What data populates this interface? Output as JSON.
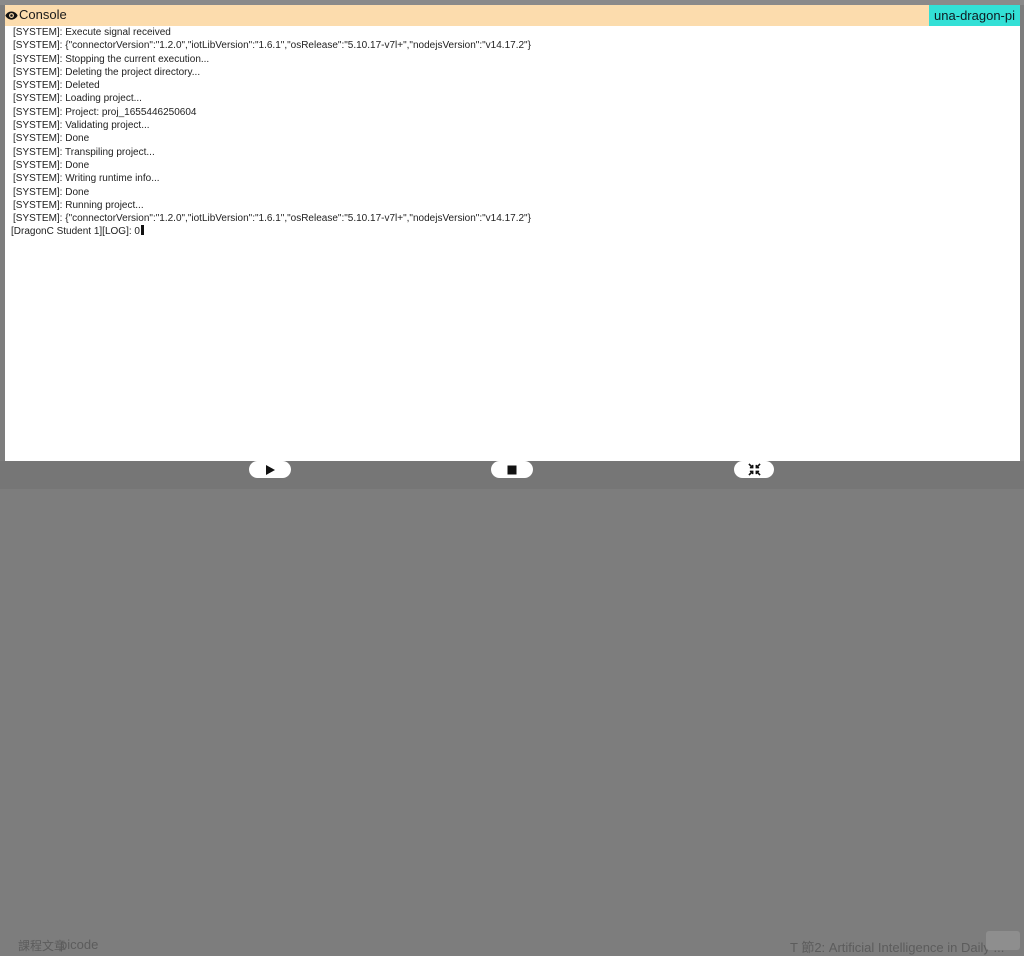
{
  "background": {
    "bottom_left_1": "課程文章",
    "bottom_left_2": "picode",
    "bottom_right": "T 節2: Artificial Intelligence in Daily ..."
  },
  "header": {
    "title": "Console",
    "device": "una-dragon-pi",
    "colors": {
      "header_bg": "#fcdcad",
      "device_bg": "#33e0d6"
    }
  },
  "console": {
    "lines": [
      "[SYSTEM]: Execute signal received",
      "[SYSTEM]: {\"connectorVersion\":\"1.2.0\",\"iotLibVersion\":\"1.6.1\",\"osRelease\":\"5.10.17-v7l+\",\"nodejsVersion\":\"v14.17.2\"}",
      "[SYSTEM]: Stopping the current execution...",
      "[SYSTEM]: Deleting the project directory...",
      "[SYSTEM]: Deleted",
      "[SYSTEM]: Loading project...",
      "[SYSTEM]: Project: proj_1655446250604",
      "[SYSTEM]: Validating project...",
      "[SYSTEM]: Done",
      "[SYSTEM]: Transpiling project...",
      "[SYSTEM]: Done",
      "[SYSTEM]: Writing runtime info...",
      "[SYSTEM]: Done",
      "[SYSTEM]: Running project...",
      "[SYSTEM]: {\"connectorVersion\":\"1.2.0\",\"iotLibVersion\":\"1.6.1\",\"osRelease\":\"5.10.17-v7l+\",\"nodejsVersion\":\"v14.17.2\"}",
      "[DragonC Student 1][LOG]: 0"
    ]
  },
  "controls": {
    "play": "play-icon",
    "stop": "stop-icon",
    "shrink": "shrink-icon"
  }
}
